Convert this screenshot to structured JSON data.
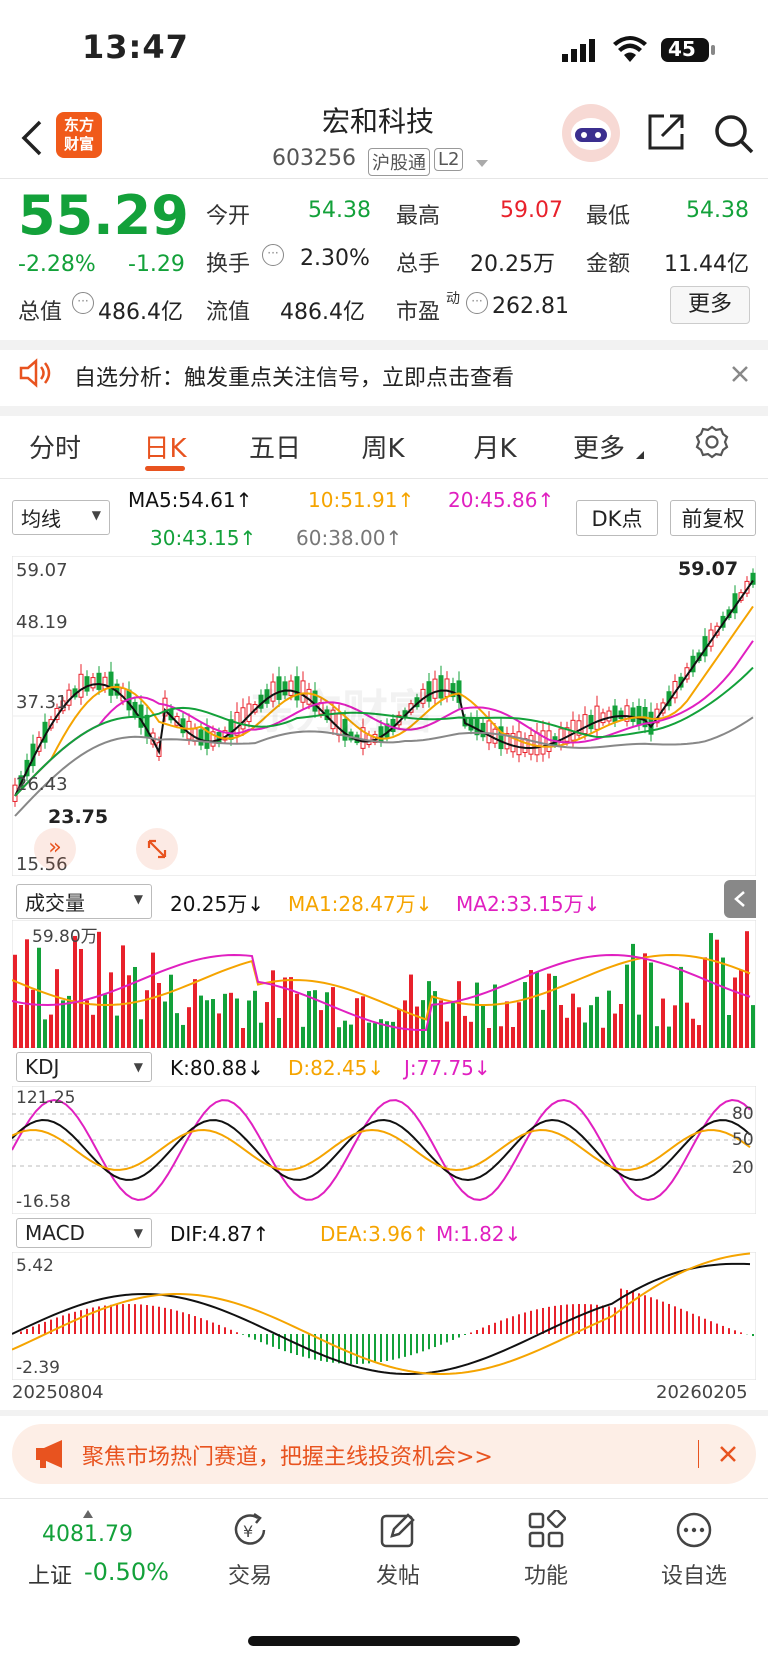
{
  "status": {
    "time": "13:47",
    "battery": "45"
  },
  "header": {
    "logo": "东方\n财富",
    "title": "宏和科技",
    "code": "603256",
    "market_chip": "沪股通",
    "level_chip": "L2"
  },
  "quote": {
    "price": "55.29",
    "change_pct": "-2.28%",
    "change": "-1.29",
    "open_label": "今开",
    "open": "54.38",
    "high_label": "最高",
    "high": "59.07",
    "low_label": "最低",
    "low": "54.38",
    "turnover_label": "换手",
    "turnover": "2.30%",
    "volume_label": "总手",
    "volume": "20.25万",
    "amount_label": "金额",
    "amount": "11.44亿",
    "mktcap_label": "总值",
    "mktcap": "486.4亿",
    "float_label": "流值",
    "float": "486.4亿",
    "pe_label": "市盈",
    "pe_sup": "动",
    "pe": "262.81",
    "more_button": "更多"
  },
  "notice": {
    "text": "自选分析：触发重点关注信号，立即点击查看"
  },
  "tabs": [
    "分时",
    "日K",
    "五日",
    "周K",
    "月K",
    "更多"
  ],
  "active_tab": "日K",
  "ma": {
    "selector": "均线",
    "ma5": "MA5:54.61↑",
    "ma10": "10:51.91↑",
    "ma20": "20:45.86↑",
    "ma30": "30:43.15↑",
    "ma60": "60:38.00↑",
    "dk_button": "DK点",
    "adjust_button": "前复权"
  },
  "kline": {
    "y_labels": [
      "59.07",
      "48.19",
      "37.31",
      "26.43",
      "15.56"
    ],
    "high_marker": "59.07",
    "low_marker": "23.75",
    "watermark": "东方财富"
  },
  "volume": {
    "selector": "成交量",
    "value": "20.25万↓",
    "ma1": "MA1:28.47万↓",
    "ma2": "MA2:33.15万↓",
    "max_label": "59.80万"
  },
  "kdj": {
    "selector": "KDJ",
    "k": "K:80.88↓",
    "d": "D:82.45↓",
    "j": "J:77.75↓",
    "top": "121.25",
    "bottom": "-16.58",
    "levels": [
      "80",
      "50",
      "20"
    ]
  },
  "macd": {
    "selector": "MACD",
    "dif": "DIF:4.87↑",
    "dea": "DEA:3.96↑",
    "m": "M:1.82↓",
    "top": "5.42",
    "bottom": "-2.39",
    "start_date": "20250804",
    "end_date": "20260205"
  },
  "promo": {
    "text": "聚焦市场热门赛道，把握主线投资机会>>"
  },
  "bottom_nav": {
    "index_value": "4081.79",
    "index_name": "上证",
    "index_change": "-0.50%",
    "items": [
      "交易",
      "发帖",
      "功能",
      "设自选"
    ]
  },
  "colors": {
    "up": "#e8212b",
    "down": "#13a13a",
    "accent": "#e8531f"
  }
}
